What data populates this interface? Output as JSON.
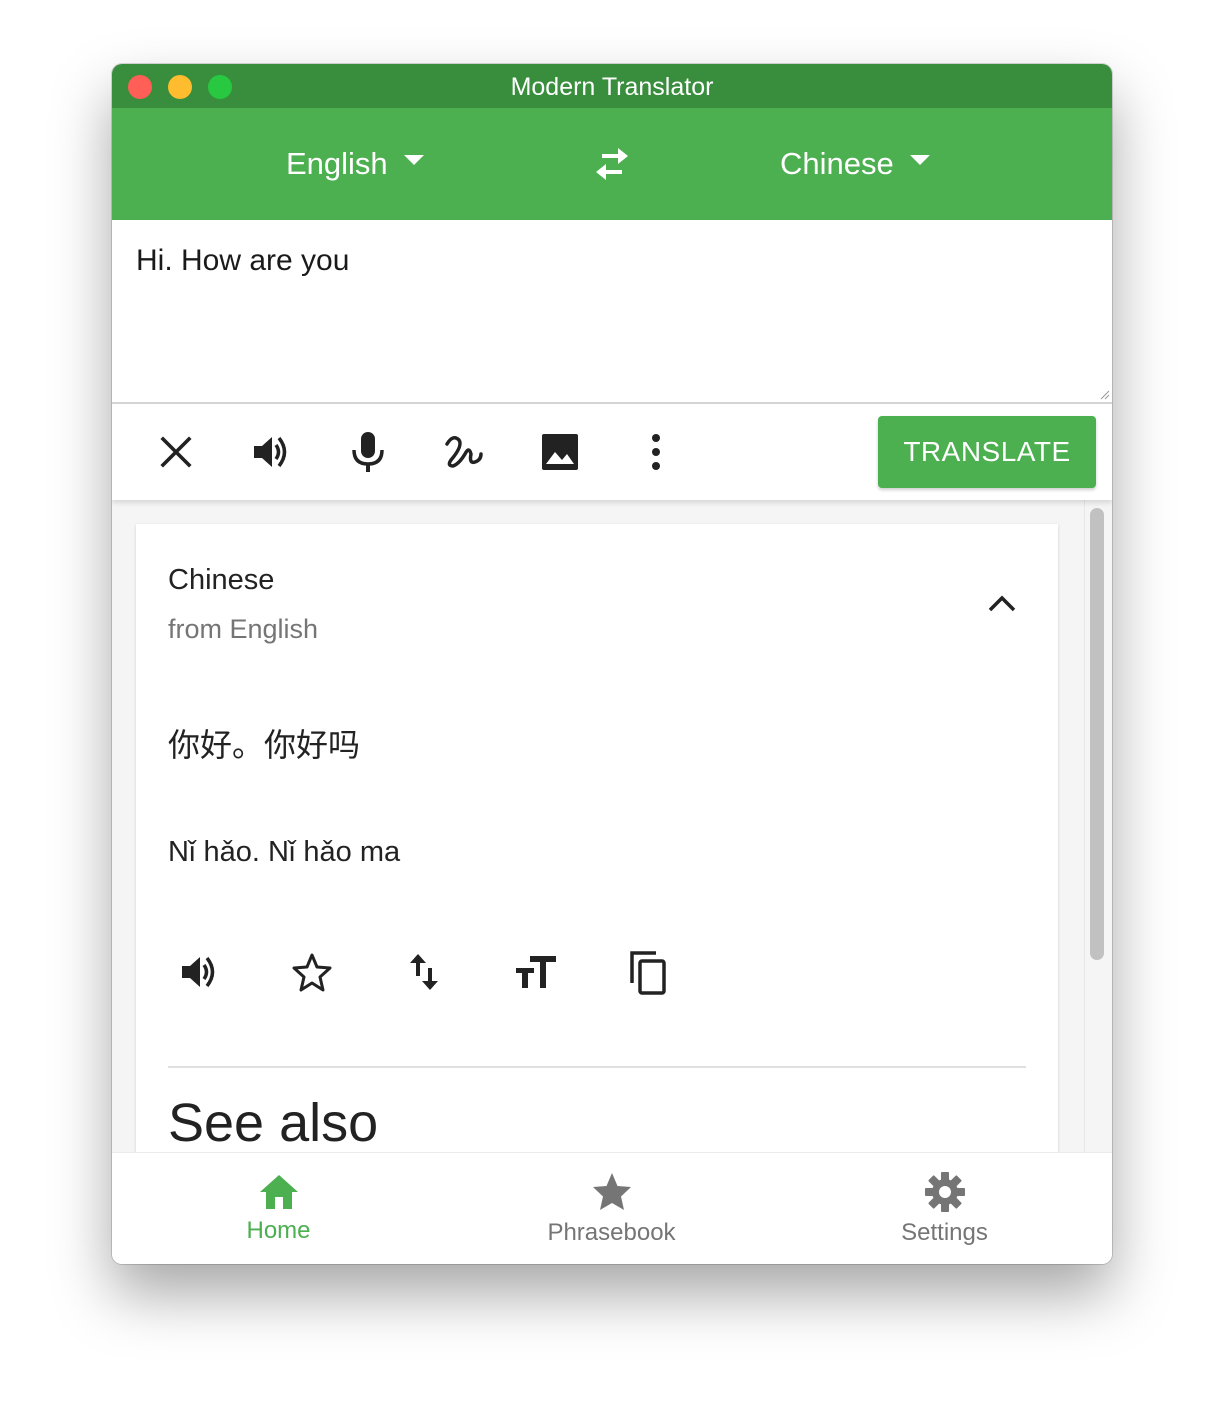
{
  "window": {
    "title": "Modern Translator"
  },
  "appbar": {
    "from_language": "English",
    "to_language": "Chinese"
  },
  "input": {
    "text": "Hi. How are you"
  },
  "toolbar": {
    "translate_label": "TRANSLATE"
  },
  "result": {
    "language": "Chinese",
    "from_label": "from English",
    "translation": "你好。你好吗",
    "pronunciation": "Nǐ hǎo. Nǐ hǎo ma",
    "see_also_heading": "See also"
  },
  "nav": {
    "items": [
      {
        "label": "Home",
        "icon": "home-icon",
        "active": true
      },
      {
        "label": "Phrasebook",
        "icon": "star-icon",
        "active": false
      },
      {
        "label": "Settings",
        "icon": "gear-icon",
        "active": false
      }
    ]
  },
  "colors": {
    "primary": "#4caf50",
    "primary_dark": "#388e3c",
    "text": "#222222",
    "muted": "#757575"
  }
}
